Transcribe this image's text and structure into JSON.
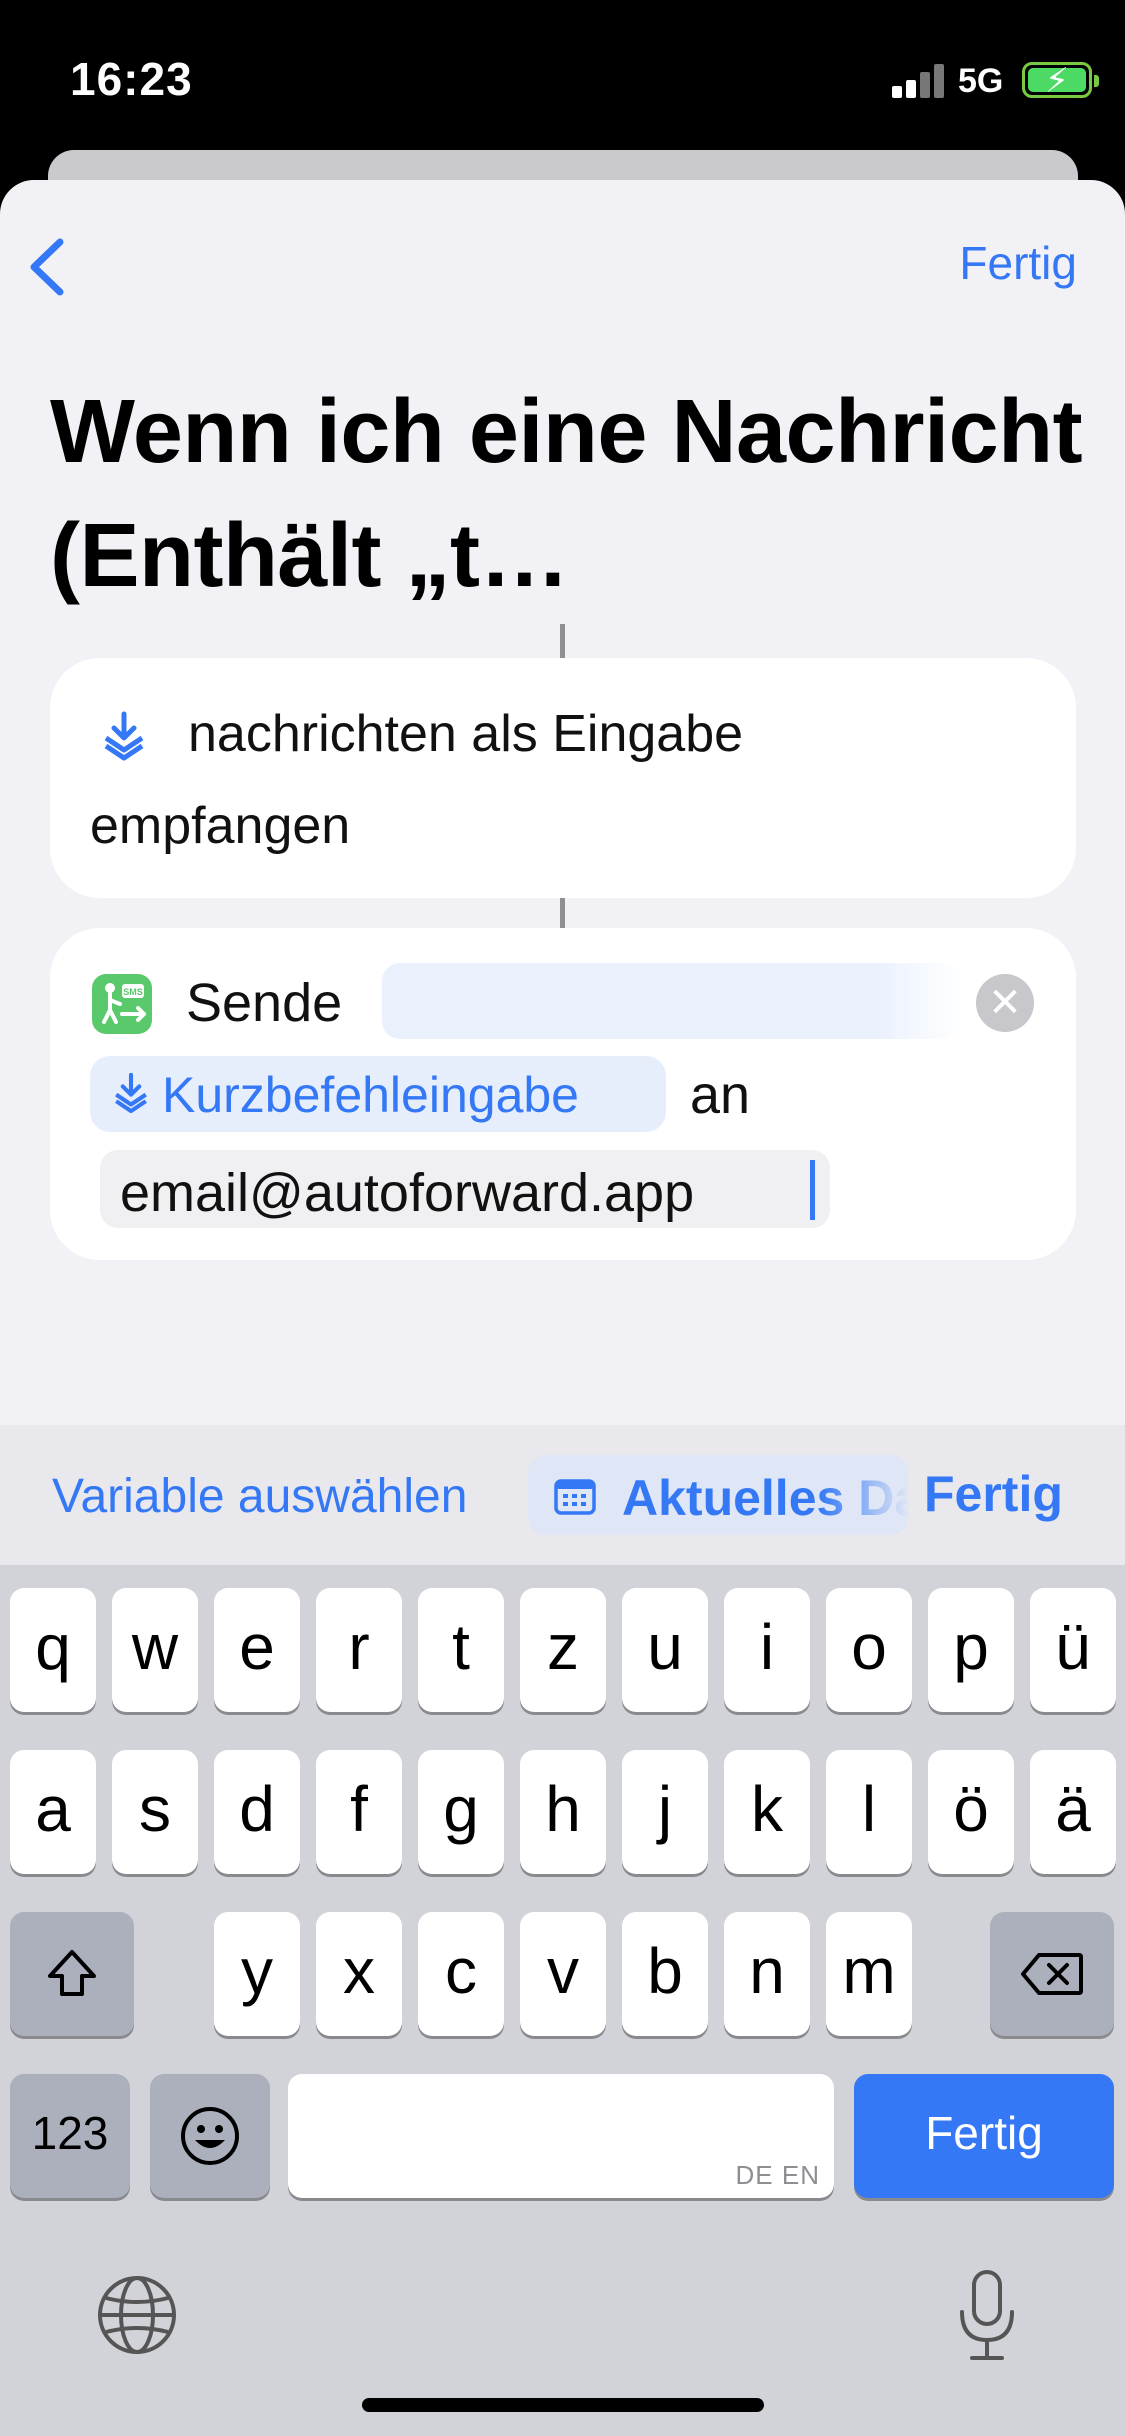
{
  "status_bar": {
    "time": "16:23",
    "network": "5G",
    "icons": [
      "signal-icon",
      "battery-charging-icon"
    ]
  },
  "nav": {
    "done_label": "Fertig",
    "back_icon": "chevron-left-icon"
  },
  "title": "Wenn ich eine Nachricht (Enthält „t…",
  "trigger_card": {
    "icon": "shortcut-input-icon",
    "line1": "nachrichten als Eingabe",
    "line2": "empfangen"
  },
  "action_card": {
    "icon": "sms-forward-icon",
    "send_label": "Sende",
    "variable_label": "Kurzbefehleingabe",
    "to_label": "an",
    "recipient": "email@autoforward.app"
  },
  "toolbar": {
    "choose_variable": "Variable auswählen",
    "date_chip": "Aktuelles Datum",
    "done": "Fertig"
  },
  "keyboard": {
    "row1": [
      "q",
      "w",
      "e",
      "r",
      "t",
      "z",
      "u",
      "i",
      "o",
      "p",
      "ü"
    ],
    "row2": [
      "a",
      "s",
      "d",
      "f",
      "g",
      "h",
      "j",
      "k",
      "l",
      "ö",
      "ä"
    ],
    "row3": [
      "y",
      "x",
      "c",
      "v",
      "b",
      "n",
      "m"
    ],
    "numbers_key": "123",
    "space_hint": "DE EN",
    "return_key": "Fertig"
  },
  "colors": {
    "accent": "#3478f6",
    "sheet_bg": "#f2f2f6",
    "keyboard_bg": "#d1d3d9"
  }
}
